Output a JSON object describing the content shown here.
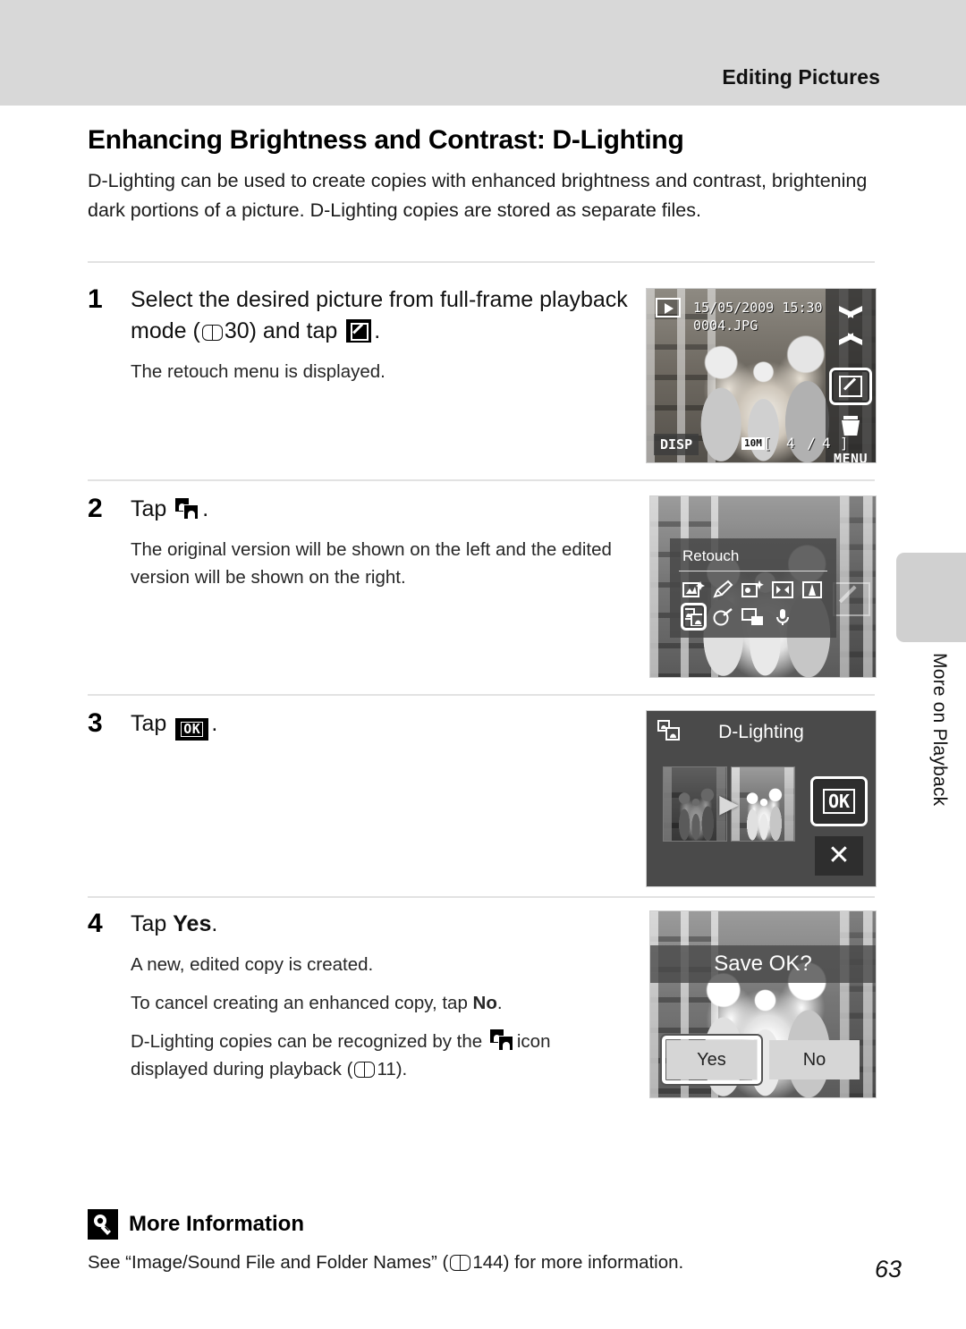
{
  "header": {
    "section_title": "Editing Pictures"
  },
  "page": {
    "title": "Enhancing Brightness and Contrast: D-Lighting",
    "intro": "D-Lighting can be used to create copies with enhanced brightness and contrast, brightening dark portions of a picture. D-Lighting copies are stored as separate files.",
    "number": "63",
    "side_tab": "More on Playback"
  },
  "steps": [
    {
      "number": "1",
      "head_part1": "Select the desired picture from full-frame playback mode (",
      "head_ref": "30",
      "head_part2": ") and tap",
      "head_part3": ".",
      "notes": [
        "The retouch menu is displayed."
      ]
    },
    {
      "number": "2",
      "head_part1": "Tap",
      "head_part3": ".",
      "notes": [
        "The original version will be shown on the left and the edited version will be shown on the right."
      ]
    },
    {
      "number": "3",
      "head_part1": "Tap",
      "head_part3": ".",
      "notes": []
    },
    {
      "number": "4",
      "head_part1": "Tap",
      "head_bold": "Yes",
      "head_part3": ".",
      "notes": [
        "A new, edited copy is created.",
        "To cancel creating an enhanced copy, tap No.",
        "D-Lighting copies can be recognized by the icon displayed during playback (11)."
      ],
      "note2_prefix": "To cancel creating an enhanced copy, tap ",
      "note2_bold": "No",
      "note2_suffix": ".",
      "note3_prefix": "D-Lighting copies can be recognized by the",
      "note3_mid": "icon",
      "note3_line2_prefix": "displayed during playback (",
      "note3_ref": "11",
      "note3_suffix": ")."
    }
  ],
  "screens": {
    "playback": {
      "date": "15/05/2009 15:30",
      "filename": "0004.JPG",
      "disp_label": "DISP",
      "menu_label": "MENU",
      "resolution_badge": "10M",
      "frame_counter_open": "[",
      "frame_current": "4 /",
      "frame_total": "4",
      "frame_counter_close": "]",
      "icons": {
        "playback_mode": "play-icon",
        "scroll_up": "chevron-up-icon",
        "scroll_down": "chevron-down-icon",
        "retouch": "retouch-icon",
        "delete": "trash-icon"
      }
    },
    "retouch_menu": {
      "title": "Retouch",
      "items": [
        {
          "name": "quick-retouch-icon"
        },
        {
          "name": "paint-icon"
        },
        {
          "name": "skin-softening-icon"
        },
        {
          "name": "perspective-control-icon"
        },
        {
          "name": "contrast-icon"
        },
        {
          "name": "d-lighting-icon",
          "selected": true
        },
        {
          "name": "filter-effects-icon"
        },
        {
          "name": "small-picture-icon"
        },
        {
          "name": "voice-memo-icon"
        }
      ]
    },
    "d_lighting_preview": {
      "title": "D-Lighting",
      "arrow": "▶",
      "ok_label": "OK",
      "cancel_label": "✕",
      "thumb_before_label": "original-thumbnail",
      "thumb_after_label": "edited-thumbnail"
    },
    "save_confirm": {
      "banner": "Save OK?",
      "yes_label": "Yes",
      "no_label": "No",
      "selected": "Yes"
    }
  },
  "more_information": {
    "heading": "More Information",
    "body_prefix": "See “Image/Sound File and Folder Names” (",
    "body_ref": "144",
    "body_suffix": ") for more information."
  },
  "colors": {
    "header_band": "#d8d8d8",
    "rule": "#e2e2e2",
    "side_tab": "#d0d0d0",
    "text": "#1a1a1a"
  }
}
